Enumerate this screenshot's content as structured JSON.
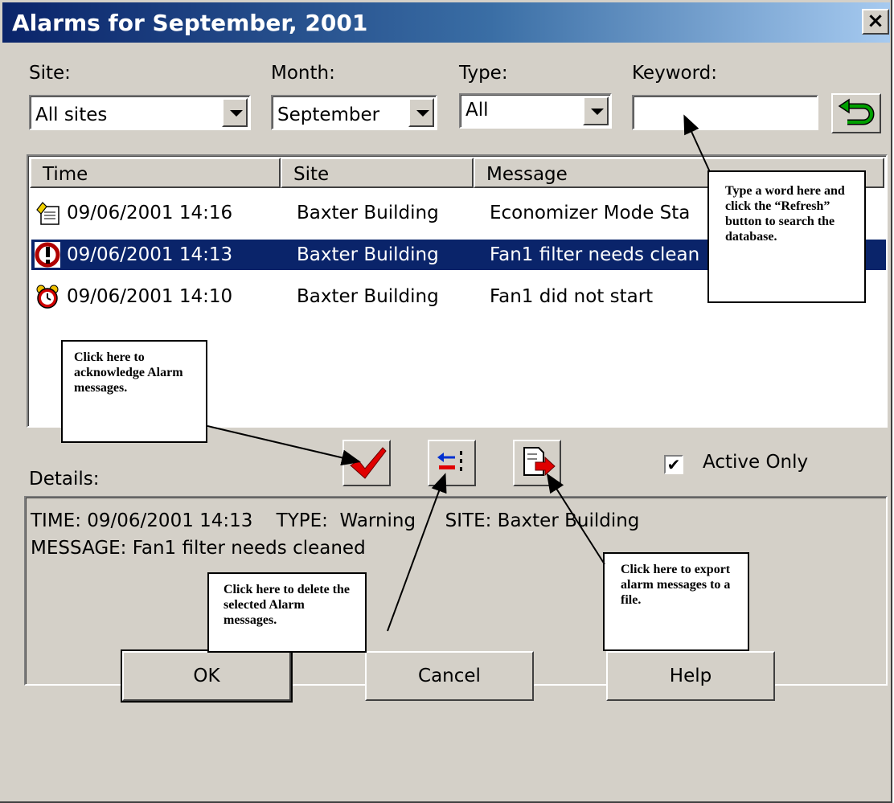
{
  "window": {
    "title": "Alarms for September, 2001",
    "close_label": "×"
  },
  "filters": {
    "site_label": "Site:",
    "site_value": "All sites",
    "month_label": "Month:",
    "month_value": "September",
    "type_label": "Type:",
    "type_value": "All",
    "keyword_label": "Keyword:",
    "keyword_value": ""
  },
  "list": {
    "columns": [
      "Time",
      "Site",
      "Message"
    ],
    "rows": [
      {
        "time": "09/06/2001 14:16",
        "site": "Baxter Building",
        "message": "Economizer Mode Sta",
        "icon": "info-note-icon"
      },
      {
        "time": "09/06/2001 14:13",
        "site": "Baxter Building",
        "message": "Fan1 filter needs clean",
        "icon": "warning-icon"
      },
      {
        "time": "09/06/2001 14:10",
        "site": "Baxter Building",
        "message": "Fan1 did not start",
        "icon": "alarm-clock-icon"
      }
    ]
  },
  "details": {
    "label": "Details:",
    "line1": "TIME: 09/06/2001 14:13    TYPE:  Warning     SITE: Baxter Building",
    "line2": "MESSAGE: Fan1 filter needs cleaned"
  },
  "active_only": {
    "label": "Active Only",
    "checked": true
  },
  "buttons": {
    "ok": "OK",
    "cancel": "Cancel",
    "help": "Help"
  },
  "callouts": {
    "refresh": "Type a word here and click the “Refresh” button to search the database.",
    "acknowledge": "Click here to acknowledge Alarm messages.",
    "delete": "Click here to delete the selected Alarm messages.",
    "export": "Click here to export alarm messages to a file."
  },
  "colors": {
    "selection": "#0a246a",
    "dialog": "#d4d0c8",
    "check_red": "#e00000",
    "refresh_green": "#00a000"
  }
}
